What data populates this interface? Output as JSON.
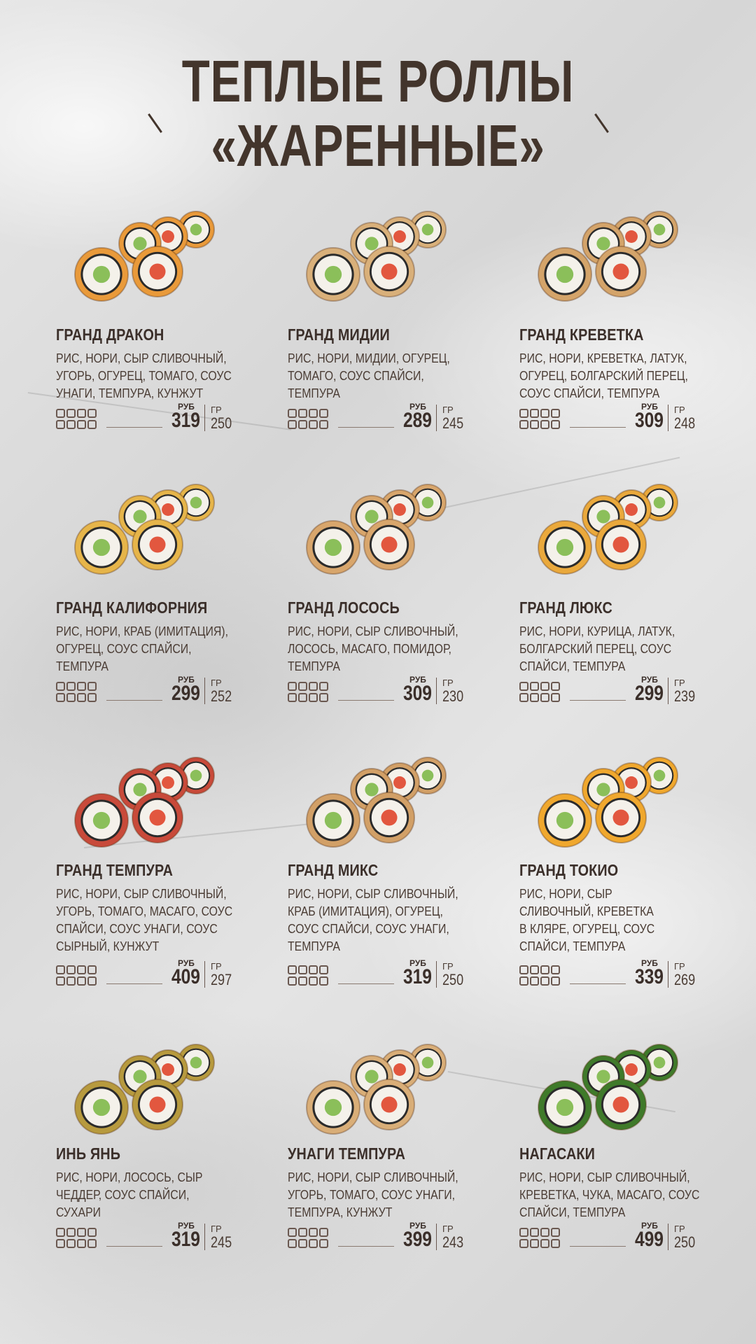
{
  "title": {
    "line1": "ТЕПЛЫЕ РОЛЛЫ",
    "line2": "«ЖАРЕННЫЕ»"
  },
  "labels": {
    "currency": "РУБ",
    "weight_unit": "ГР"
  },
  "items": [
    {
      "name": "ГРАНД ДРАКОН",
      "desc": [
        "РИС, НОРИ, СЫР СЛИВОЧНЫЙ,",
        "УГОРЬ, ОГУРЕЦ, ТОМАГО, СОУС",
        "УНАГИ, ТЕМПУРА, КУНЖУТ"
      ],
      "price": "319",
      "weight": "250",
      "coating": "#e99a3a"
    },
    {
      "name": "ГРАНД МИДИИ",
      "desc": [
        "РИС, НОРИ, МИДИИ, ОГУРЕЦ,",
        "ТОМАГО, СОУС СПАЙСИ,",
        "ТЕМПУРА"
      ],
      "price": "289",
      "weight": "245",
      "coating": "#d9b07a"
    },
    {
      "name": "ГРАНД КРЕВЕТКА",
      "desc": [
        "РИС, НОРИ, КРЕВЕТКА, ЛАТУК,",
        "ОГУРЕЦ, БОЛГАРСКИЙ ПЕРЕЦ,",
        "СОУС СПАЙСИ, ТЕМПУРА"
      ],
      "price": "309",
      "weight": "248",
      "coating": "#d4a46a"
    },
    {
      "name": "ГРАНД КАЛИФОРНИЯ",
      "desc": [
        "РИС, НОРИ, КРАБ (ИМИТАЦИЯ),",
        "ОГУРЕЦ, СОУС СПАЙСИ,",
        "ТЕМПУРА"
      ],
      "price": "299",
      "weight": "252",
      "coating": "#e6b54a"
    },
    {
      "name": "ГРАНД ЛОСОСЬ",
      "desc": [
        "РИС, НОРИ, СЫР СЛИВОЧНЫЙ,",
        "ЛОСОСЬ, МАСАГО, ПОМИДОР,",
        "ТЕМПУРА"
      ],
      "price": "309",
      "weight": "230",
      "coating": "#d8a66c"
    },
    {
      "name": "ГРАНД ЛЮКС",
      "desc": [
        "РИС, НОРИ, КУРИЦА, ЛАТУК,",
        "БОЛГАРСКИЙ ПЕРЕЦ, СОУС",
        "СПАЙСИ, ТЕМПУРА"
      ],
      "price": "299",
      "weight": "239",
      "coating": "#eaa93c"
    },
    {
      "name": "ГРАНД ТЕМПУРА",
      "desc": [
        "РИС, НОРИ, СЫР СЛИВОЧНЫЙ,",
        "УГОРЬ, ТОМАГО, МАСАГО, СОУС",
        "СПАЙСИ, СОУС УНАГИ, СОУС",
        "СЫРНЫЙ, КУНЖУТ"
      ],
      "price": "409",
      "weight": "297",
      "coating": "#c84a3a"
    },
    {
      "name": "ГРАНД МИКС",
      "desc": [
        "РИС, НОРИ, СЫР СЛИВОЧНЫЙ,",
        "КРАБ (ИМИТАЦИЯ), ОГУРЕЦ,",
        "СОУС СПАЙСИ, СОУС УНАГИ,",
        "ТЕМПУРА"
      ],
      "price": "319",
      "weight": "250",
      "coating": "#d2a067"
    },
    {
      "name": "ГРАНД ТОКИО",
      "desc": [
        "РИС, НОРИ, СЫР",
        "СЛИВОЧНЫЙ, КРЕВЕТКА",
        "В КЛЯРЕ, ОГУРЕЦ, СОУС",
        "СПАЙСИ, ТЕМПУРА"
      ],
      "price": "339",
      "weight": "269",
      "coating": "#f0a82e"
    },
    {
      "name": "ИНЬ ЯНЬ",
      "desc": [
        "РИС, НОРИ, ЛОСОСЬ, СЫР",
        "ЧЕДДЕР, СОУС СПАЙСИ,",
        "СУХАРИ"
      ],
      "price": "319",
      "weight": "245",
      "coating": "#b79a3e"
    },
    {
      "name": "УНАГИ ТЕМПУРА",
      "desc": [
        "РИС, НОРИ, СЫР СЛИВОЧНЫЙ,",
        "УГОРЬ, ТОМАГО, СОУС УНАГИ,",
        "ТЕМПУРА, КУНЖУТ"
      ],
      "price": "399",
      "weight": "243",
      "coating": "#d9ae78"
    },
    {
      "name": "НАГАСАКИ",
      "desc": [
        "РИС, НОРИ, СЫР СЛИВОЧНЫЙ,",
        "КРЕВЕТКА, ЧУКА, МАСАГО, СОУС",
        "СПАЙСИ, ТЕМПУРА"
      ],
      "price": "499",
      "weight": "250",
      "coating": "#3f7a2a"
    }
  ]
}
